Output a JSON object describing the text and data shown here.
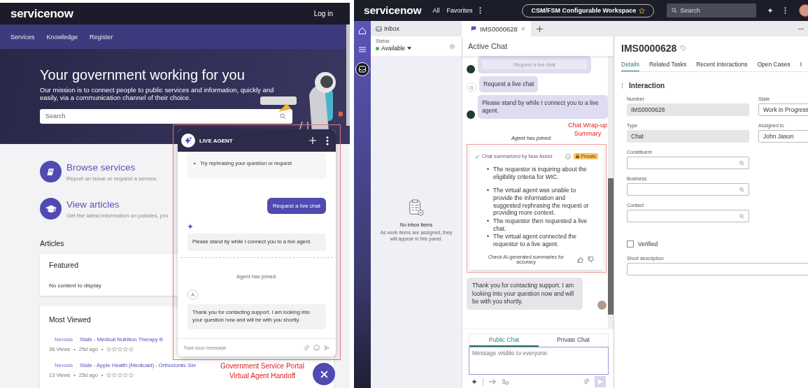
{
  "portal": {
    "brand": "servicenow",
    "login": "Log in",
    "nav": [
      {
        "label": "Services"
      },
      {
        "label": "Knowledge"
      },
      {
        "label": "Register"
      }
    ],
    "hero": {
      "title": "Your government working for you",
      "subtitle": "Our mission is to connect people to public services and information, quickly and easily, via a communication channel of their choice.",
      "search": {
        "placeholder": "Search"
      }
    },
    "quick_links": [
      {
        "kind": "services",
        "title": "Browse services",
        "description": "Report an issue or request a service."
      },
      {
        "kind": "articles",
        "title": "View articles",
        "description": "Get the latest information on policies, pro"
      }
    ],
    "articles": {
      "heading": "Articles",
      "featured": {
        "title": "Featured",
        "empty": "No content to display"
      },
      "most_viewed": {
        "title": "Most Viewed",
        "separator": "•",
        "items": [
          {
            "category": "Nevada",
            "title": "State - Medical Nutrition Therapy B",
            "views": "36 Views",
            "age": "25d ago",
            "stars": 0
          },
          {
            "category": "Nevada",
            "title": "State - Apple Health (Medicaid) - Orthodontic Ser",
            "views": "13 Views",
            "age": "25d ago",
            "stars": 0
          }
        ]
      }
    },
    "chat_widget": {
      "title": "LIVE AGENT",
      "messages": [
        {
          "kind": "bullets",
          "bullet": "•",
          "items": [
            "Try rephrasing your question or request"
          ]
        },
        {
          "kind": "user",
          "text": "Request a live chat"
        },
        {
          "kind": "bot",
          "text": "Please stand by while I connect you to a live agent."
        },
        {
          "kind": "system",
          "text": "Agent has joined."
        },
        {
          "kind": "agent",
          "avatar": "A",
          "text": "Thank you for contacting support. I am looking into your question now and will be with you shortly."
        }
      ],
      "input": {
        "placeholder": "Type your message"
      }
    },
    "annotation": "Government Service Portal Virtual Agent Handoff"
  },
  "workspace": {
    "brand": "servicenow",
    "menu": [
      {
        "label": "All"
      },
      {
        "label": "Favorites"
      }
    ],
    "workspace_name": "CSM/FSM Configurable Workspace",
    "search": {
      "placeholder": "Search"
    },
    "rail": [
      {
        "kind": "home",
        "selected": false
      },
      {
        "kind": "list",
        "selected": false
      },
      {
        "kind": "inbox",
        "selected": true
      }
    ],
    "inbox_label": "Inbox",
    "tabs": [
      {
        "label": "IMS0000628",
        "selected": true
      }
    ],
    "inbox": {
      "status_label": "Status",
      "status": "Available",
      "empty_title": "No inbox items",
      "empty_text": "As work items are assigned, they will appear in this panel."
    },
    "chat": {
      "title": "Active Chat",
      "messages": [
        {
          "kind": "bot_button",
          "text": "Request a live chat"
        },
        {
          "kind": "user",
          "avatar": "G",
          "text": "Request a live chat"
        },
        {
          "kind": "bot",
          "text": "Please stand by while I connect you to a live agent."
        },
        {
          "kind": "system",
          "text": "Agent has joined."
        },
        {
          "kind": "summary",
          "title": "Chat summarized by Now Assist",
          "badge": "Private",
          "bullet": "•",
          "items": [
            "The requestor is inquiring about the eligibility criteria for WIC.",
            "The virtual agent was unable to provide the information and suggested rephrasing the request or providing more context.",
            "The requestor then requested a live chat.",
            "The virtual agent connected the requestor to a live agent."
          ],
          "footer": "Check AI-generated summaries for accuracy"
        },
        {
          "kind": "agent",
          "text": "Thank you for contacting support. I am looking into your question now and will be with you shortly."
        }
      ],
      "annotation": "Chat Wrap-up Summary",
      "composer_tabs": [
        {
          "label": "Public Chat",
          "selected": true
        },
        {
          "label": "Private Chat",
          "selected": false
        }
      ],
      "composer": {
        "placeholder": "Message visible to everyone"
      }
    },
    "record": {
      "title": "IMS0000628",
      "tabs": [
        {
          "label": "Details",
          "selected": true
        },
        {
          "label": "Related Tasks",
          "selected": false
        },
        {
          "label": "Recent Interactions",
          "selected": false
        },
        {
          "label": "Open Cases",
          "selected": false
        },
        {
          "label": "I",
          "selected": false
        }
      ],
      "section": "Interaction",
      "primary_fields": [
        {
          "kind": "readonly",
          "label": "Number",
          "value": "IMS0000628"
        },
        {
          "kind": "readonly",
          "label": "Type",
          "value": "Chat"
        },
        {
          "kind": "lookup",
          "label": "Constituent"
        },
        {
          "kind": "lookup",
          "label": "Business"
        },
        {
          "kind": "lookup",
          "label": "Contact"
        },
        {
          "kind": "checkbox",
          "label": "Verified",
          "checked": false
        }
      ],
      "secondary_fields": [
        {
          "kind": "text",
          "label": "State",
          "value": "Work in Progress"
        },
        {
          "kind": "text",
          "label": "Assigned to",
          "value": "John Jason"
        }
      ],
      "wide_fields": [
        {
          "kind": "text",
          "label": "Short description"
        }
      ]
    }
  }
}
